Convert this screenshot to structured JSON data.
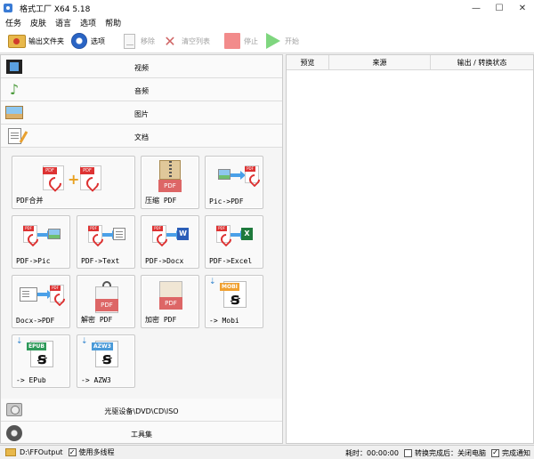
{
  "window": {
    "title": "格式工厂 X64 5.18",
    "minimize": "—",
    "maximize": "☐",
    "close": "✕"
  },
  "menu": [
    "任务",
    "皮肤",
    "语言",
    "选项",
    "帮助"
  ],
  "toolbar": {
    "output_folder": "输出文件夹",
    "options": "选项",
    "remove": "移除",
    "clear_list": "清空列表",
    "stop": "停止",
    "start": "开始"
  },
  "categories": {
    "video": "视频",
    "audio": "音频",
    "picture": "图片",
    "document": "文档",
    "rom": "光驱设备\\DVD\\CD\\ISO",
    "toolbox": "工具集"
  },
  "tools": [
    {
      "label": "PDF合并"
    },
    {
      "label": "压缩 PDF"
    },
    {
      "label": "Pic->PDF"
    },
    {
      "label": "PDF->Pic"
    },
    {
      "label": "PDF->Text"
    },
    {
      "label": "PDF->Docx"
    },
    {
      "label": "PDF->Excel"
    },
    {
      "label": "Docx->PDF"
    },
    {
      "label": "解密 PDF"
    },
    {
      "label": "加密 PDF"
    },
    {
      "label": "-> Mobi"
    },
    {
      "label": "-> EPub"
    },
    {
      "label": "-> AZW3"
    }
  ],
  "icon_text": {
    "pdf": "PDF",
    "word": "W",
    "excel": "X",
    "mobi": "MOBI",
    "epub": "EPUB",
    "azw3": "AZW3",
    "download": "⇣",
    "plus": "+"
  },
  "task_list": {
    "columns": [
      "预览",
      "来源",
      "输出 / 转换状态"
    ]
  },
  "status": {
    "output_path": "D:\\FFOutput",
    "multithread_label": "使用多线程",
    "multithread_checked": true,
    "elapsed_label": "耗时：00:00:00",
    "after_convert_label": "转换完成后：关闭电脑",
    "after_convert_checked": false,
    "notify_label": "完成通知",
    "notify_checked": true,
    "check_mark": "✓"
  },
  "colors": {
    "accent_pdf": "#dd3333",
    "start_green": "#7fd67f",
    "stop_red": "#f28b8b"
  }
}
